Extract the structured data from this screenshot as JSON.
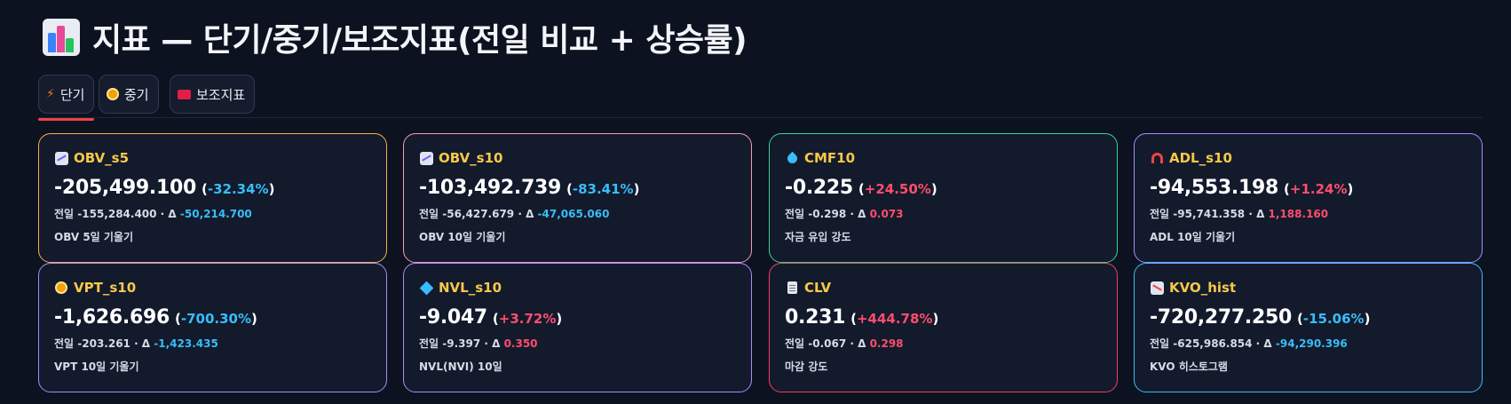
{
  "page": {
    "title": "지표 — 단기/중기/보조지표(전일 비교 + 상승률)",
    "title_icon": "bar-chart-icon"
  },
  "tabs": [
    {
      "label": "단기",
      "icon": "lightning-icon",
      "active": true
    },
    {
      "label": "중기",
      "icon": "compass-icon",
      "active": false
    },
    {
      "label": "보조지표",
      "icon": "toolbox-icon",
      "active": false
    }
  ],
  "colors": {
    "up": "#ff4d6d",
    "down": "#38bdf8",
    "name": "#f7c948",
    "background": "#0d1220",
    "card_bg": "#131a2c"
  },
  "cards": [
    {
      "name": "OBV_s5",
      "icon": "chart-increasing-icon",
      "value": "-205,499.100",
      "pct_open": "(",
      "pct": "-32.34%",
      "pct_close": ")",
      "prev_text": "전일 -155,284.400 · Δ ",
      "delta": "-50,214.700",
      "desc": "OBV 5일 기울기",
      "border": "#f2b24d"
    },
    {
      "name": "OBV_s10",
      "icon": "chart-increasing-icon",
      "value": "-103,492.739",
      "pct_open": "(",
      "pct": "-83.41%",
      "pct_close": ")",
      "prev_text": "전일 -56,427.679 · Δ ",
      "delta": "-47,065.060",
      "desc": "OBV 10일 기울기",
      "border": "#f59ab0"
    },
    {
      "name": "CMF10",
      "icon": "droplet-icon",
      "value": "-0.225",
      "pct_open": "(",
      "pct": "+24.50%",
      "pct_close": ")",
      "prev_text": "전일 -0.298 · Δ ",
      "delta": "0.073",
      "desc": "자금 유입 강도",
      "border": "#34d399"
    },
    {
      "name": "ADL_s10",
      "icon": "magnet-icon",
      "value": "-94,553.198",
      "pct_open": "(",
      "pct": "+1.24%",
      "pct_close": ")",
      "prev_text": "전일 -95,741.358 · Δ ",
      "delta": "1,188.160",
      "desc": "ADL 10일 기울기",
      "border": "#a78bfa"
    },
    {
      "name": "VPT_s10",
      "icon": "compass-icon",
      "value": "-1,626.696",
      "pct_open": "(",
      "pct": "-700.30%",
      "pct_close": ")",
      "prev_text": "전일 -203.261 · Δ ",
      "delta": "-1,423.435",
      "desc": "VPT 10일 기울기",
      "border": "#a78bfa"
    },
    {
      "name": "NVL_s10",
      "icon": "cube-icon",
      "value": "-9.047",
      "pct_open": "(",
      "pct": "+3.72%",
      "pct_close": ")",
      "prev_text": "전일 -9.397 · Δ ",
      "delta": "0.350",
      "desc": "NVL(NVI) 10일",
      "border": "#a78bfa"
    },
    {
      "name": "CLV",
      "icon": "document-icon",
      "value": "0.231",
      "pct_open": "(",
      "pct": "+444.78%",
      "pct_close": ")",
      "prev_text": "전일 -0.067 · Δ ",
      "delta": "0.298",
      "desc": "마감 강도",
      "border": "#f43f5e"
    },
    {
      "name": "KVO_hist",
      "icon": "chart-decreasing-icon",
      "value": "-720,277.250",
      "pct_open": "(",
      "pct": "-15.06%",
      "pct_close": ")",
      "prev_text": "전일 -625,986.854 · Δ ",
      "delta": "-94,290.396",
      "desc": "KVO 히스토그램",
      "border": "#38bdf8"
    }
  ]
}
